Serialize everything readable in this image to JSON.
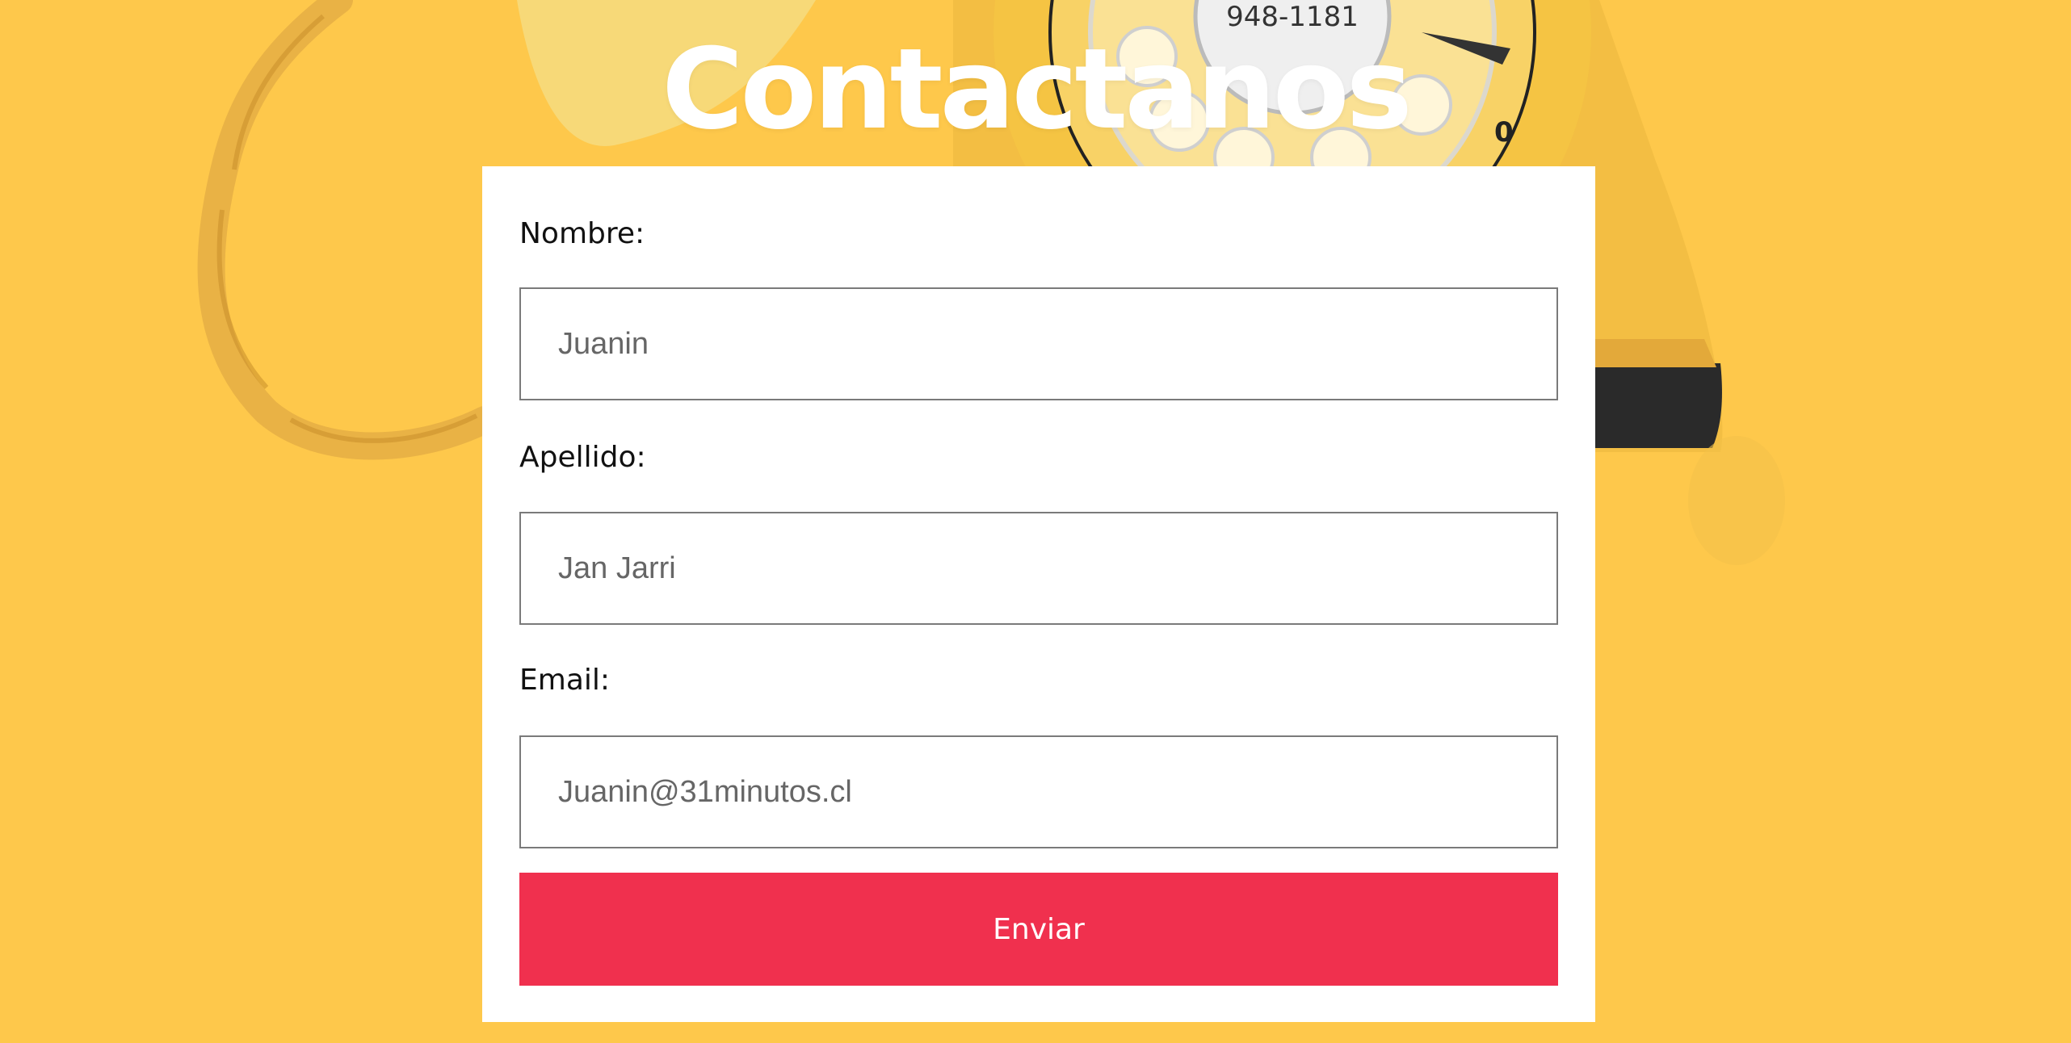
{
  "page": {
    "title": "Contactanos"
  },
  "background": {
    "dial_number": "948-1181"
  },
  "form": {
    "fields": [
      {
        "label": "Nombre:",
        "placeholder": "Juanin"
      },
      {
        "label": "Apellido:",
        "placeholder": "Jan Jarri"
      },
      {
        "label": "Email:",
        "placeholder": "Juanin@31minutos.cl"
      }
    ],
    "submit_label": "Enviar"
  },
  "colors": {
    "background": "#FEC84B",
    "button": "#F0304E",
    "card": "#FFFFFF",
    "title": "#FFFFFF"
  }
}
